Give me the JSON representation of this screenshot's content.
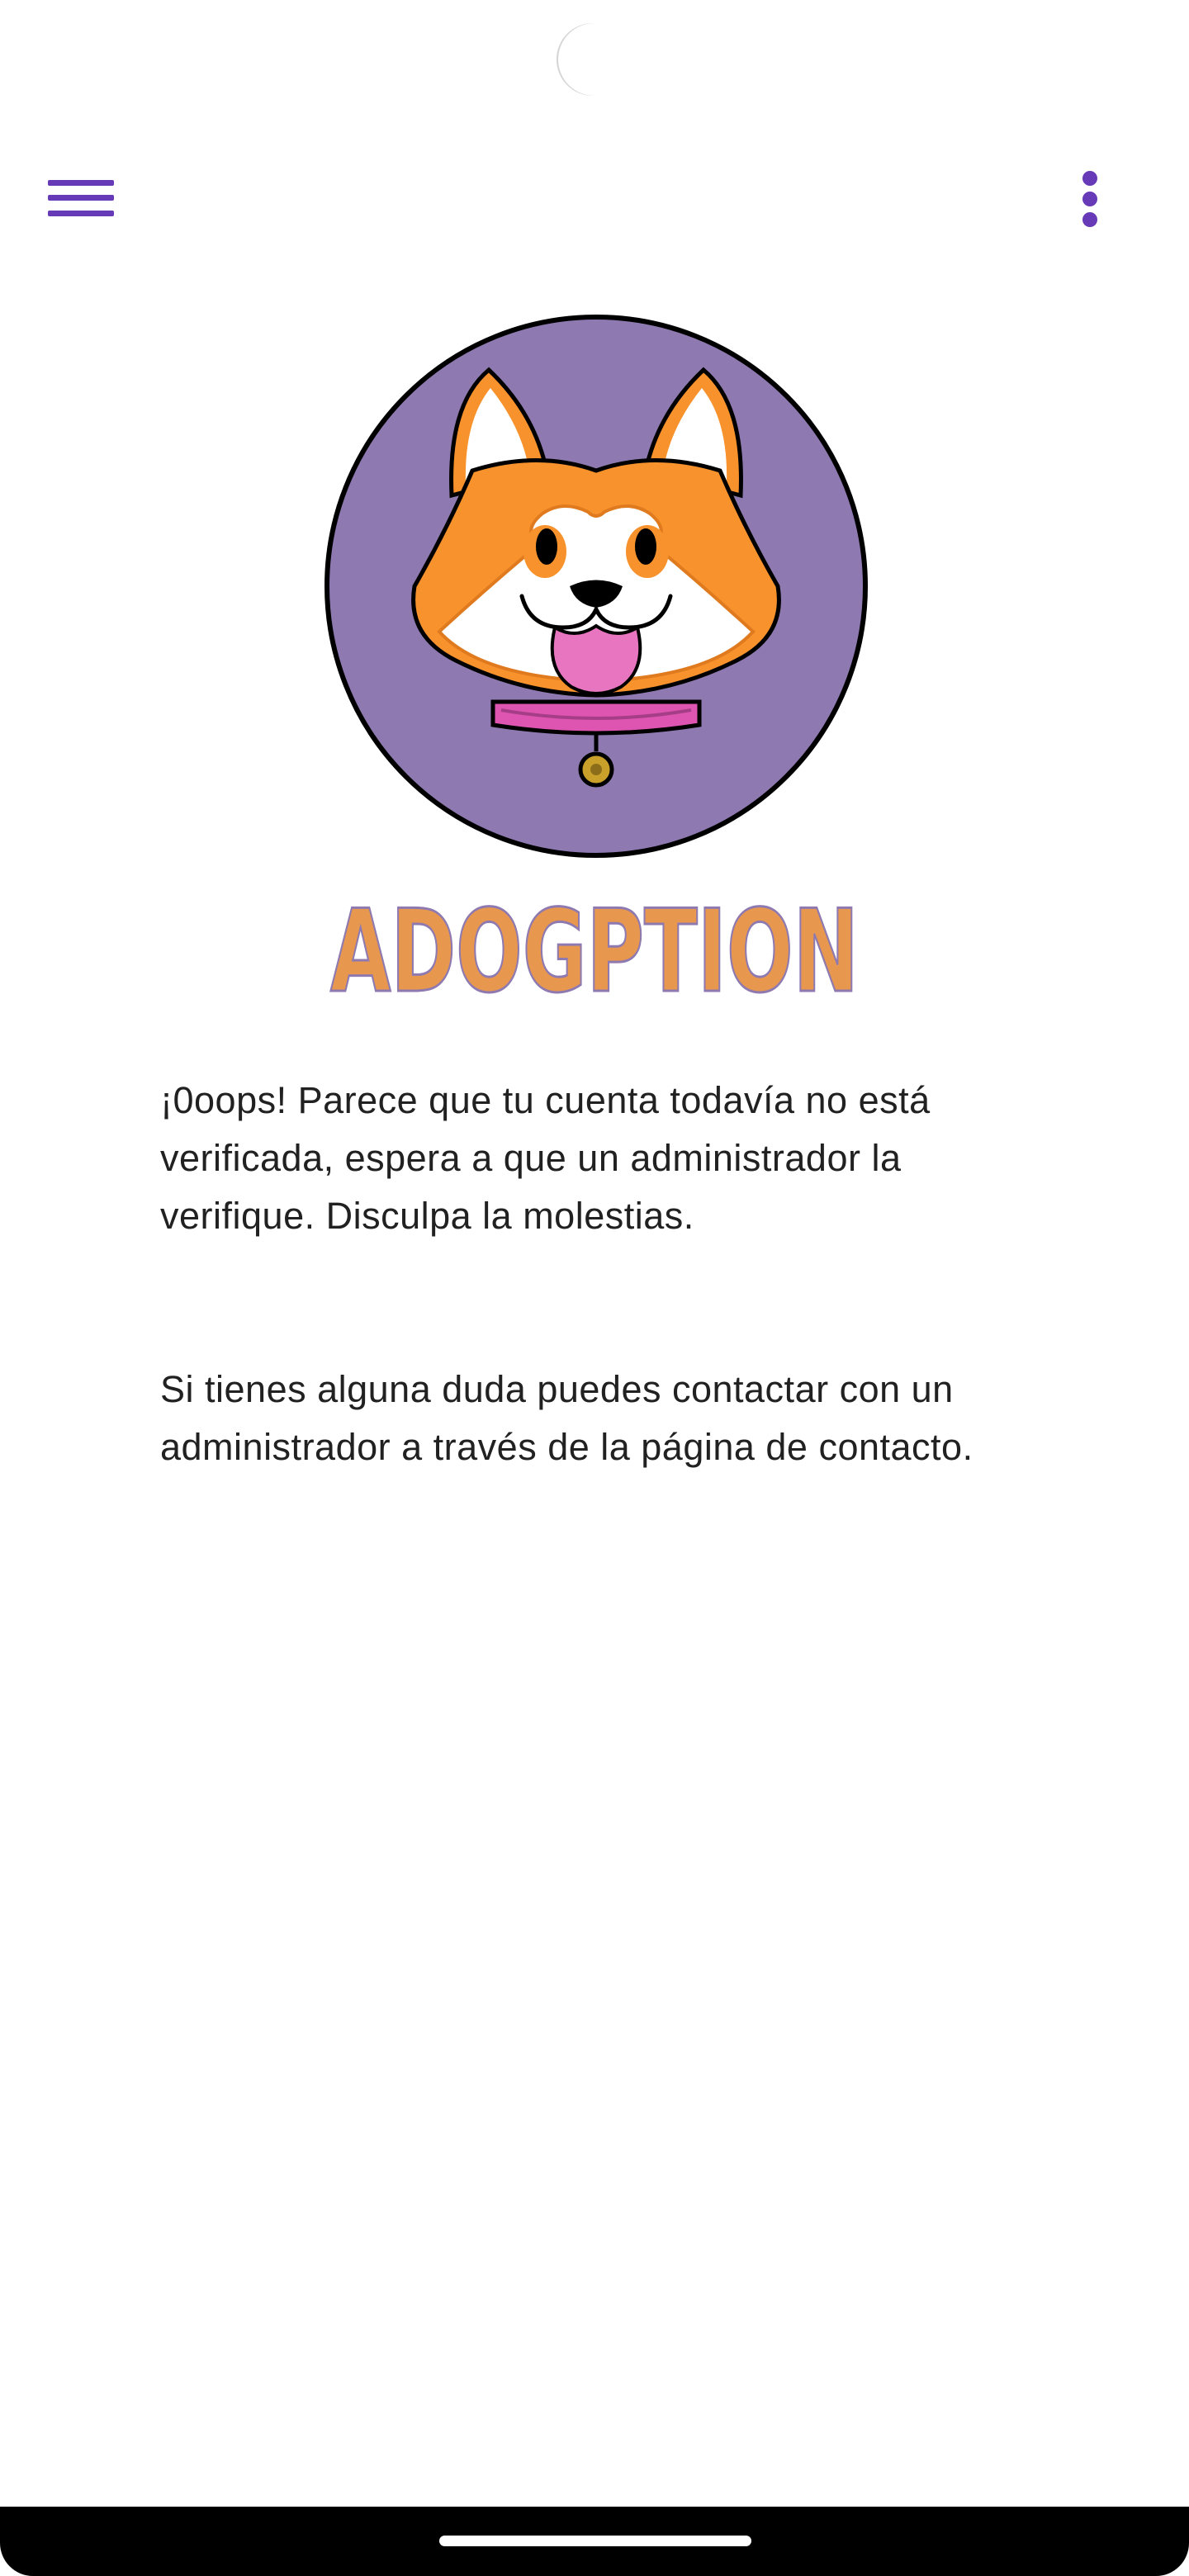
{
  "app": {
    "wordmark": "ADOGPTION"
  },
  "toolbar": {
    "menu_icon": "hamburger-menu-icon",
    "more_icon": "more-vertical-icon",
    "accent_color": "#673ab7"
  },
  "logo": {
    "icon": "corgi-dog-logo",
    "circle_color": "#8e79b0",
    "fur_color": "#f7922d",
    "collar_color": "#dd55b0",
    "wordmark_color": "#e8984e"
  },
  "message": {
    "paragraph_1": "¡0oops! Parece que tu cuenta todavía no está verificada, espera a que un administrador la verifique. Disculpa la molestias.",
    "paragraph_2": "Si tienes alguna duda puedes contactar con un administrador a través de la página de contacto."
  }
}
